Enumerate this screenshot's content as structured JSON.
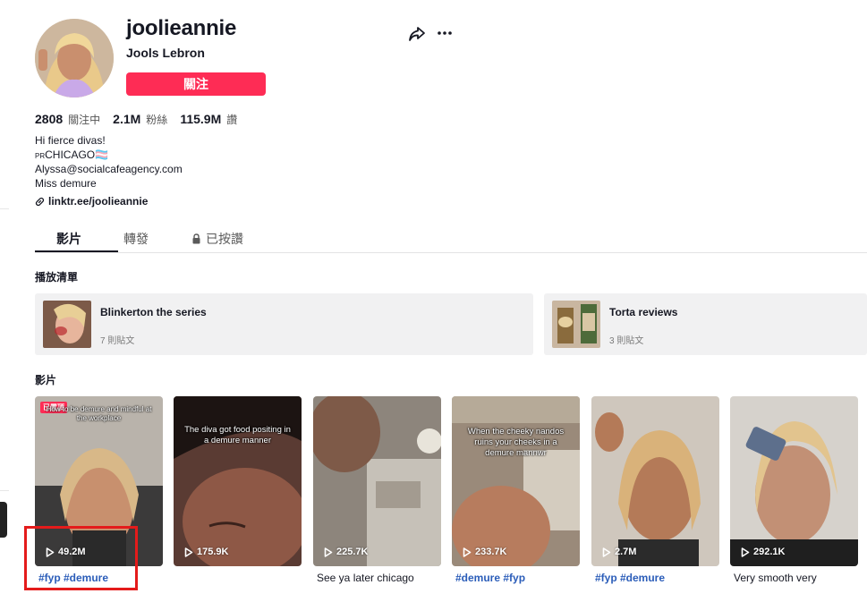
{
  "profile": {
    "username": "joolieannie",
    "nickname": "Jools Lebron",
    "follow_label": "關注",
    "stats": [
      {
        "value": "2808",
        "label": "關注中"
      },
      {
        "value": "2.1M",
        "label": "粉絲"
      },
      {
        "value": "115.9M",
        "label": "讚"
      }
    ],
    "bio": {
      "line1": "Hi fierce divas!",
      "pr_prefix": "PR",
      "line2": "CHICAGO🏳️‍⚧️",
      "line3": "Alyssa@socialcafeagency.com",
      "line4": "Miss demure"
    },
    "link": "linktr.ee/joolieannie"
  },
  "tabs": [
    {
      "label": "影片"
    },
    {
      "label": "轉發"
    },
    {
      "label": "已按讚"
    }
  ],
  "sections": {
    "playlists_title": "播放清單",
    "videos_title": "影片"
  },
  "playlists": [
    {
      "title": "Blinkerton the series",
      "count": "7 則貼文"
    },
    {
      "title": "Torta reviews",
      "count": "3 則貼文"
    }
  ],
  "videos": [
    {
      "views": "49.2M",
      "badge": "已置頂",
      "caption": "How to be demure and mindful at the workplace",
      "desc": "#fyp #demure",
      "desc_type": "hashtag"
    },
    {
      "views": "175.9K",
      "caption": "The diva got food positing in a demure manner",
      "desc": "",
      "desc_type": "plain"
    },
    {
      "views": "225.7K",
      "caption": "",
      "desc": "See ya later chicago",
      "desc_type": "plain"
    },
    {
      "views": "233.7K",
      "caption": "When the cheeky nandos ruins your cheeks in a demure mannwr",
      "desc": "#demure #fyp",
      "desc_type": "hashtag"
    },
    {
      "views": "2.7M",
      "caption": "",
      "desc": "#fyp #demure",
      "desc_type": "hashtag"
    },
    {
      "views": "292.1K",
      "caption": "",
      "desc": "Very smooth very",
      "desc_type": "plain"
    }
  ],
  "colors": {
    "accent": "#fe2c55",
    "hashtag": "#2b5db9",
    "highlight": "#e41b1b"
  },
  "icons": [
    "share-icon",
    "more-icon",
    "lock-icon",
    "link-icon",
    "play-icon"
  ]
}
